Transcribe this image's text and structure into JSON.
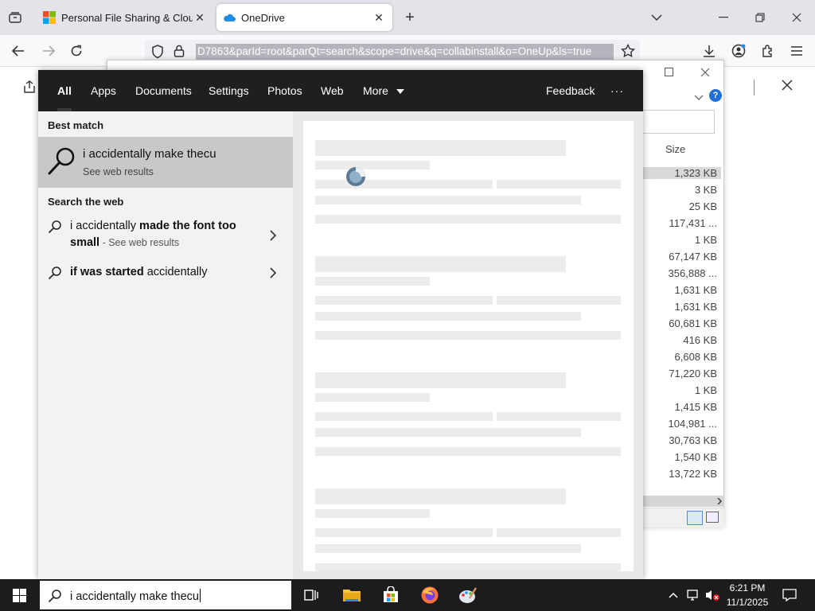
{
  "browser": {
    "tabs": [
      {
        "title": "Personal File Sharing & Cloud S",
        "favicon": "microsoft-logo-icon"
      },
      {
        "title": "OneDrive",
        "favicon": "onedrive-cloud-icon"
      }
    ],
    "url": "D7863&parId=root&parQt=search&scope=drive&q=collabinstall&o=OneUp&ls=true"
  },
  "explorer": {
    "size_header": "Size",
    "sizes": [
      "1,323 KB",
      "3 KB",
      "25 KB",
      "117,431 ...",
      "1 KB",
      "67,147 KB",
      "356,888 ...",
      "1,631 KB",
      "1,631 KB",
      "60,681 KB",
      "416 KB",
      "6,608 KB",
      "71,220 KB",
      "1 KB",
      "1,415 KB",
      "104,981 ...",
      "30,763 KB",
      "1,540 KB",
      "13,722 KB"
    ]
  },
  "search": {
    "filters": {
      "all": "All",
      "apps": "Apps",
      "documents": "Documents",
      "settings": "Settings",
      "photos": "Photos",
      "web": "Web",
      "more": "More",
      "feedback": "Feedback",
      "options": "···"
    },
    "best_match_label": "Best match",
    "best_match": {
      "title": "i accidentally make thecu",
      "subtitle": "See web results"
    },
    "search_web_label": "Search the web",
    "web_results": [
      {
        "prefix": "i accidentally ",
        "bold": "made the font too small",
        "suffix": " - See web results"
      },
      {
        "prefix": "",
        "bold": "if was started",
        "suffix": " accidentally"
      }
    ]
  },
  "taskbar": {
    "search_text": "i accidentally make thecu",
    "time": "6:21 PM",
    "date": "11/1/2025"
  },
  "colors": {
    "search_dark": "#1f1f1f",
    "panel_bg": "#f2f2f2",
    "selected": "#c8c8c8",
    "taskbar": "#1c1c1c",
    "accent_blue": "#0078d4"
  }
}
